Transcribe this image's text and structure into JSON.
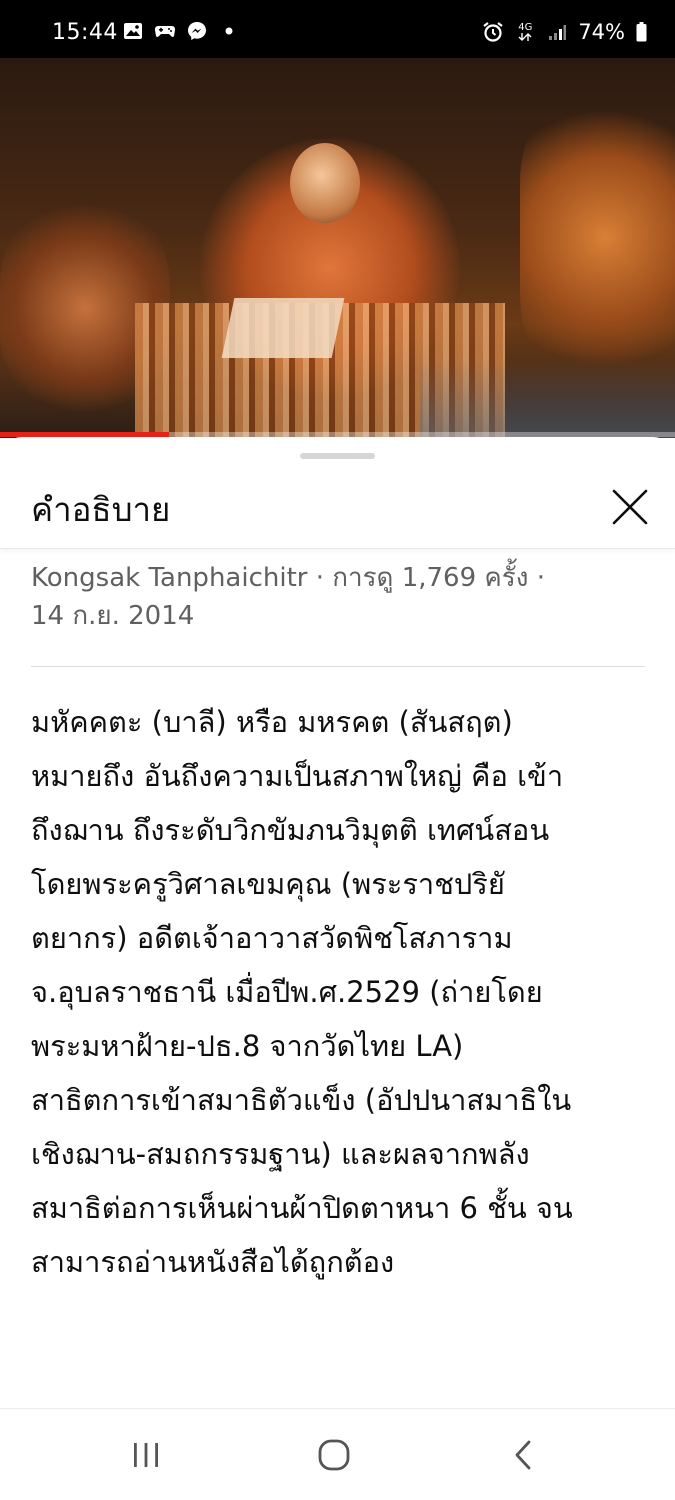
{
  "status_bar": {
    "time": "15:44",
    "battery": "74%",
    "network": "4G",
    "left_icons": [
      "image-icon",
      "game-icon",
      "messenger-icon",
      "dot-icon"
    ],
    "right_icons": [
      "alarm-icon",
      "4g-icon",
      "signal-icon",
      "battery-icon"
    ]
  },
  "video": {
    "progress": 0.25,
    "progress_color": "#e62117"
  },
  "sheet": {
    "title": "คำอธิบาย",
    "close_icon": "close-icon",
    "meta_line1": "Kongsak Tanphaichitr · การดู 1,769 ครั้ง ·",
    "meta_line2": "14 ก.ย. 2014",
    "description": "มหัคคตะ (บาลี) หรือ มหรคต (สันสฤต)\nหมายถึง อันถึงความเป็นสภาพใหญ่ คือ เข้า\nถึงฌาน ถึงระดับวิกขัมภนวิมุตติ เทศน์สอน\nโดยพระครูวิศาลเขมคุณ (พระราชปริยั\nตยากร) อดีตเจ้าอาวาสวัดพิชโสภาราม\nจ.อุบลราชธานี เมื่อปีพ.ศ.2529 (ถ่ายโดย\nพระมหาฝ้าย-ปธ.8 จากวัดไทย LA)\nสาธิตการเข้าสมาธิตัวแข็ง (อัปปนาสมาธิใน\nเชิงฌาน-สมถกรรมฐาน) และผลจากพลัง\nสมาธิต่อการเห็นผ่านผ้าปิดตาหนา 6 ชั้น จน\nสามารถอ่านหนังสือได้ถูกต้อง"
  },
  "nav_bar": {
    "buttons": [
      "recent-apps-icon",
      "home-icon",
      "back-icon"
    ]
  }
}
